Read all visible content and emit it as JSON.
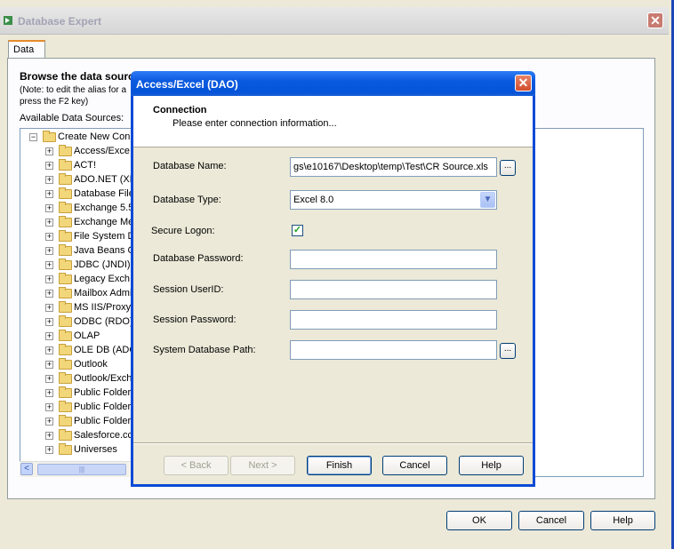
{
  "window": {
    "title": "Database Expert",
    "close_label": "✕"
  },
  "tabs": [
    {
      "label": "Data"
    }
  ],
  "panel": {
    "browse_title": "Browse the data sourc",
    "note_line1": "(Note: to edit the alias for a",
    "note_line2": "press the F2 key)",
    "available_label": "Available Data Sources:"
  },
  "tree": {
    "root": {
      "label": "Create New Conn",
      "expander": "−"
    },
    "items": [
      {
        "label": "Access/Exce"
      },
      {
        "label": "ACT!"
      },
      {
        "label": "ADO.NET (XM"
      },
      {
        "label": "Database File"
      },
      {
        "label": "Exchange 5.5"
      },
      {
        "label": "Exchange Me"
      },
      {
        "label": "File System D"
      },
      {
        "label": "Java Beans C"
      },
      {
        "label": "JDBC (JNDI)"
      },
      {
        "label": "Legacy Exch"
      },
      {
        "label": "Mailbox Admi"
      },
      {
        "label": "MS IIS/Proxy"
      },
      {
        "label": "ODBC (RDO)"
      },
      {
        "label": "OLAP"
      },
      {
        "label": "OLE DB (ADC"
      },
      {
        "label": "Outlook"
      },
      {
        "label": "Outlook/Exch"
      },
      {
        "label": "Public Folder"
      },
      {
        "label": "Public Folder"
      },
      {
        "label": "Public Folder"
      },
      {
        "label": "Salesforce.cc"
      },
      {
        "label": "Universes"
      }
    ],
    "expander": "+"
  },
  "scroll": {
    "left_arrow": "<",
    "thumb_grip": "|||"
  },
  "footer": {
    "ok": "OK",
    "cancel": "Cancel",
    "help": "Help"
  },
  "dialog": {
    "title": "Access/Excel (DAO)",
    "close_label": "✕",
    "header_title": "Connection",
    "header_subtitle": "Please enter connection information...",
    "fields": {
      "db_name_label": "Database Name:",
      "db_name_value": "gs\\e10167\\Desktop\\temp\\Test\\CR Source.xls",
      "db_type_label": "Database Type:",
      "db_type_value": "Excel 8.0",
      "secure_logon_label": "Secure Logon:",
      "secure_logon_checked": "✓",
      "db_password_label": "Database Password:",
      "session_userid_label": "Session UserID:",
      "session_password_label": "Session Password:",
      "system_db_path_label": "System Database Path:"
    },
    "browse_label": "...",
    "dropdown_arrow": "▼",
    "buttons": {
      "back": "< Back",
      "next": "Next >",
      "finish": "Finish",
      "cancel": "Cancel",
      "help": "Help"
    }
  },
  "colors": {
    "title_blue": "#0453d8",
    "checkbox_green": "#21a121",
    "tab_accent": "#e68b2c"
  }
}
